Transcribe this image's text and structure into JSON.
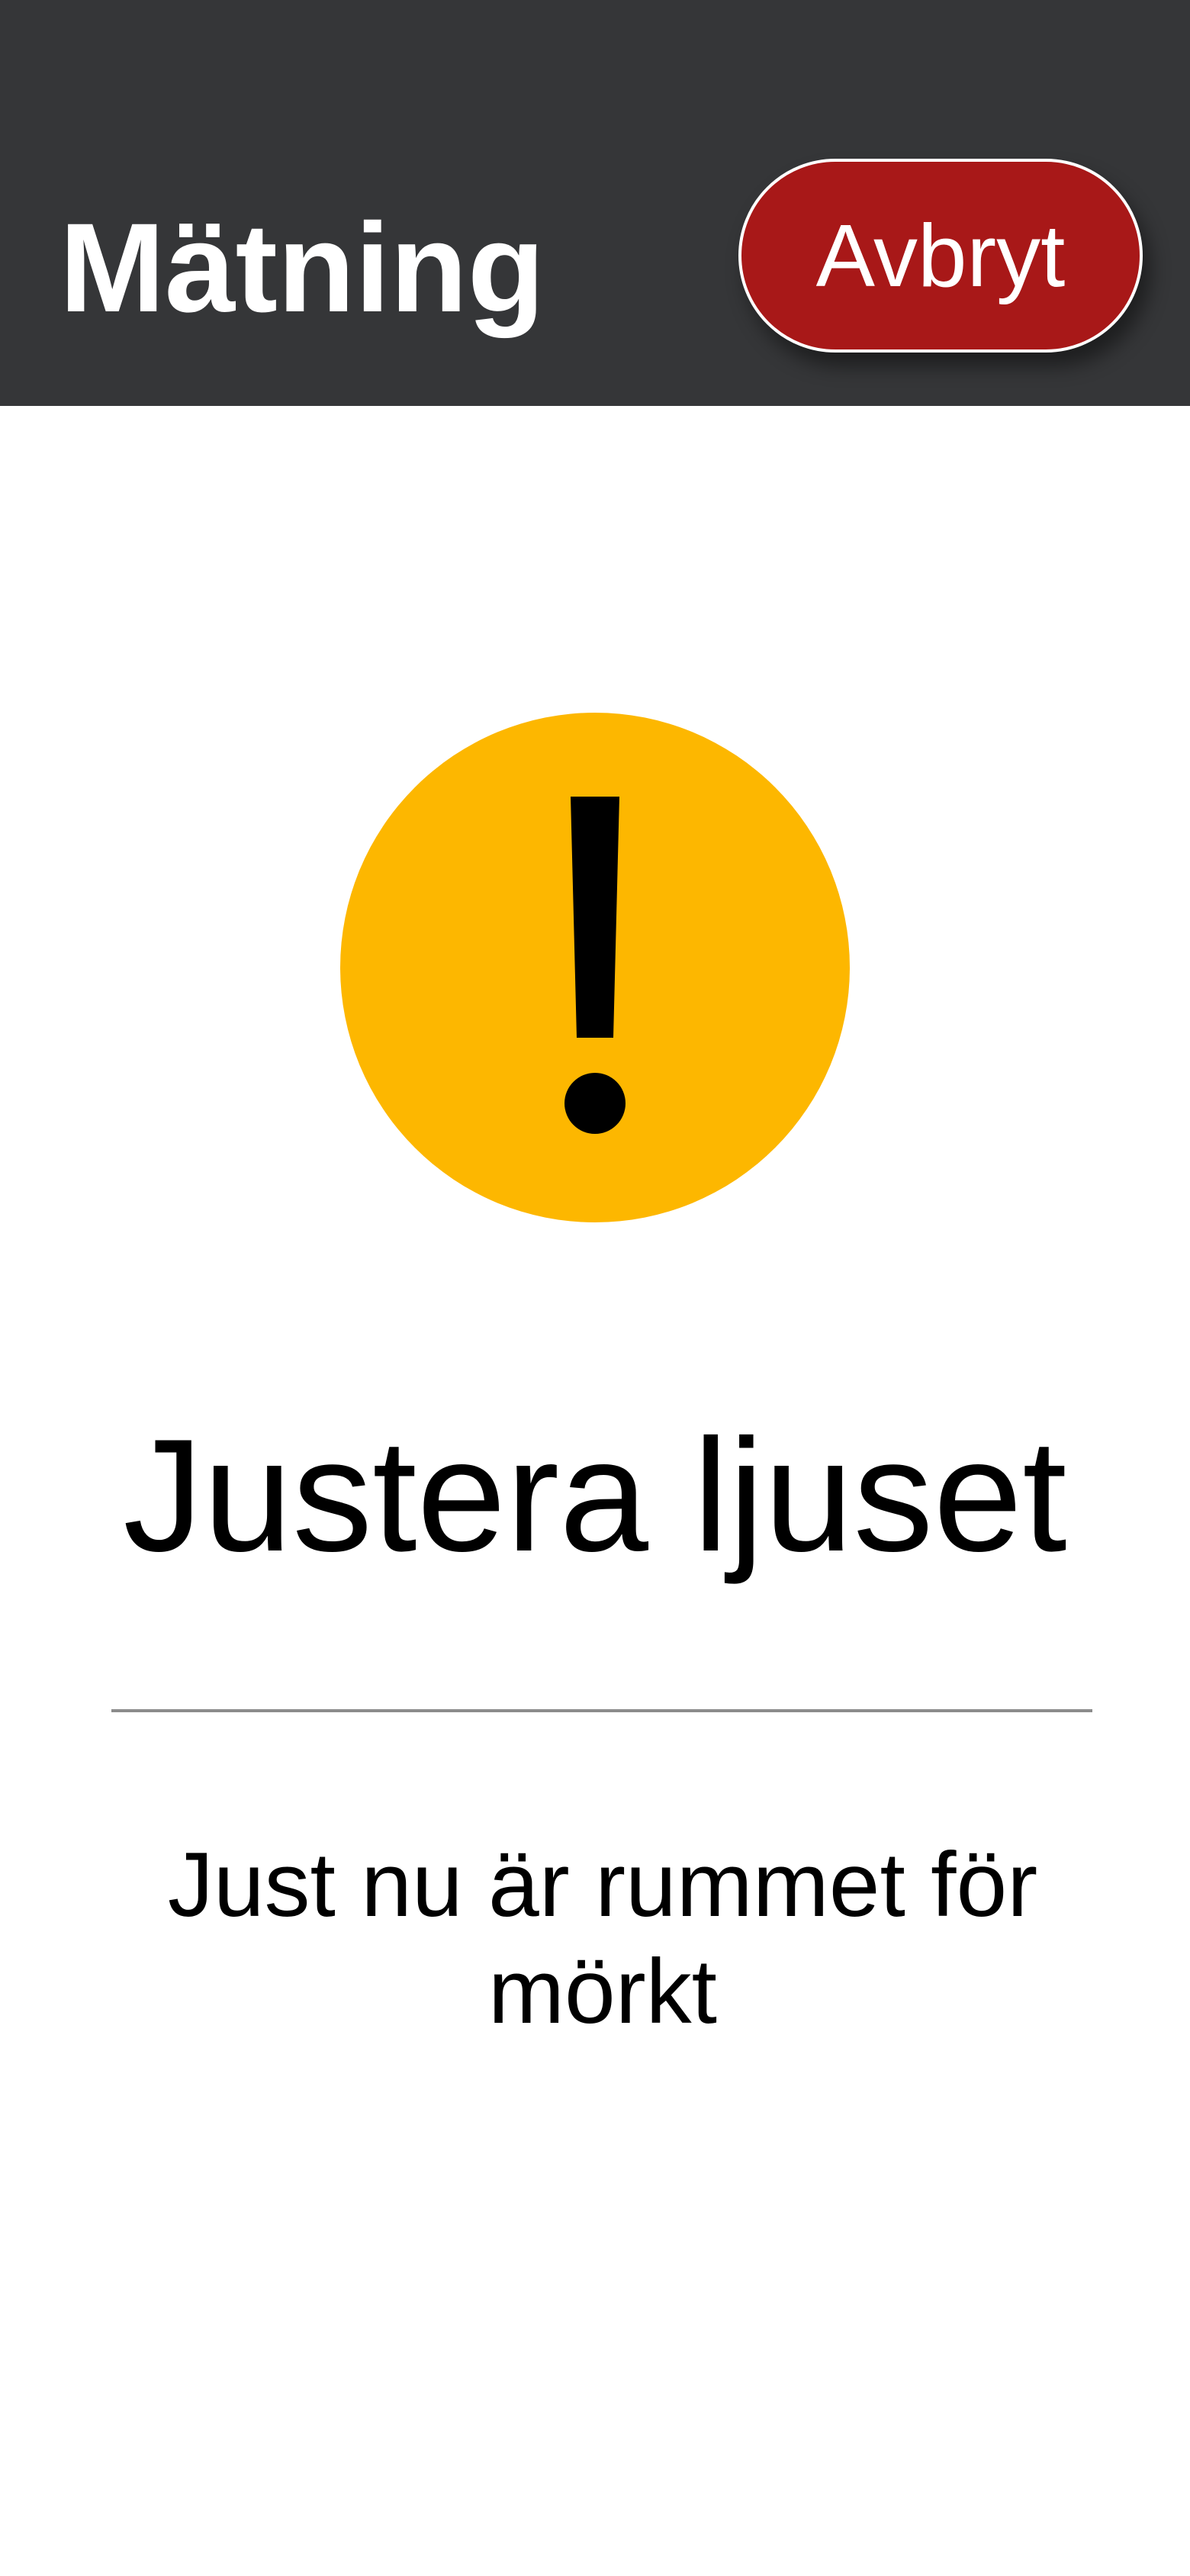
{
  "header": {
    "title": "Mätning",
    "cancel_label": "Avbryt",
    "background_color": "#353638",
    "cancel_color": "#a81818"
  },
  "warning": {
    "icon": "exclamation-warning-icon",
    "circle_color": "#fdb700"
  },
  "main": {
    "heading": "Justera ljuset",
    "message": "Just nu är rummet för mörkt"
  }
}
